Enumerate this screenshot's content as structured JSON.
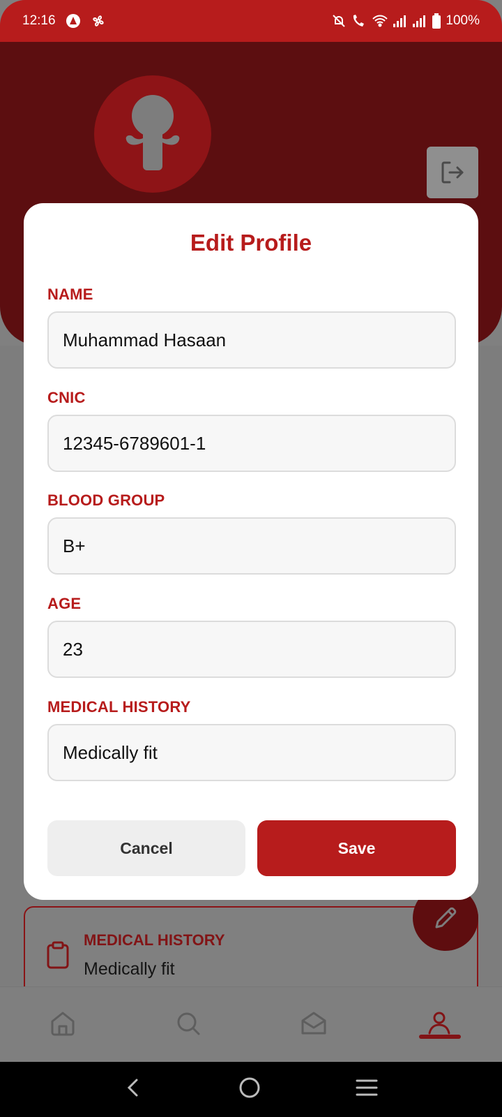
{
  "status_bar": {
    "time": "12:16",
    "battery": "100%"
  },
  "modal": {
    "title": "Edit Profile",
    "fields": [
      {
        "label": "NAME",
        "value": "Muhammad Hasaan"
      },
      {
        "label": "CNIC",
        "value": "12345-6789601-1"
      },
      {
        "label": "BLOOD GROUP",
        "value": "B+"
      },
      {
        "label": "AGE",
        "value": "23"
      },
      {
        "label": "MEDICAL HISTORY",
        "value": "Medically fit"
      }
    ],
    "cancel_label": "Cancel",
    "save_label": "Save"
  },
  "background": {
    "history_card": {
      "title": "MEDICAL HISTORY",
      "value": "Medically fit"
    }
  },
  "bottom_nav": {
    "items": [
      "home-icon",
      "search-icon",
      "mail-icon",
      "profile-icon"
    ],
    "active": "profile-icon"
  },
  "colors": {
    "primary": "#b71c1c",
    "overlay": "#808080"
  }
}
